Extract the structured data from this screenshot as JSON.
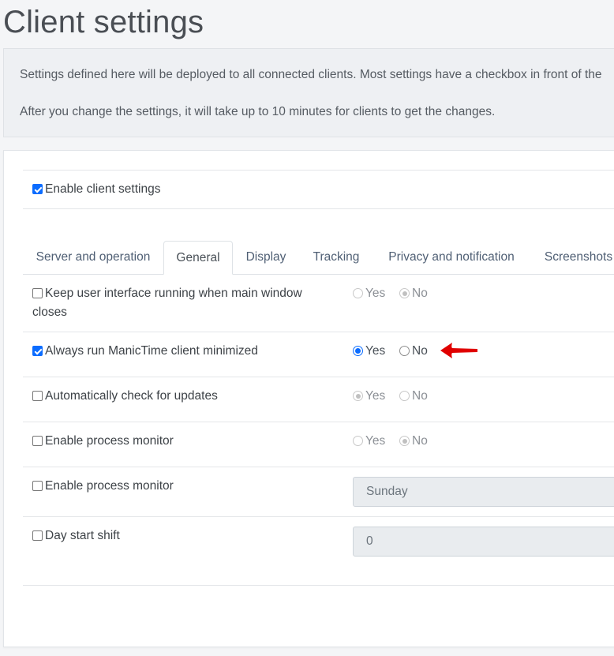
{
  "page": {
    "title": "Client settings"
  },
  "info": {
    "line1": "Settings defined here will be deployed to all connected clients. Most settings have a checkbox in front of the",
    "line2": "After you change the settings, it will take up to 10 minutes for clients to get the changes."
  },
  "enable": {
    "label": "Enable client settings",
    "checked": true
  },
  "tabs": [
    "Server and operation",
    "General",
    "Display",
    "Tracking",
    "Privacy and notification",
    "Screenshots"
  ],
  "active_tab": "General",
  "options": {
    "yes": "Yes",
    "no": "No"
  },
  "settings": [
    {
      "label_line1": "Keep user interface running when main window",
      "label_line2": "closes",
      "checked": false,
      "value": "No",
      "enabled": false
    },
    {
      "label": "Always run ManicTime client minimized",
      "checked": true,
      "value": "Yes",
      "enabled": true
    },
    {
      "label": "Automatically check for updates",
      "checked": false,
      "value": "Yes",
      "enabled": false
    },
    {
      "label": "Enable process monitor",
      "checked": false,
      "value": "No",
      "enabled": false
    },
    {
      "label": "Enable process monitor",
      "checked": false,
      "field_value": "Sunday"
    },
    {
      "label": "Day start shift",
      "checked": false,
      "field_value": "0"
    }
  ],
  "colors": {
    "accent": "#0b6cff",
    "arrow": "#e00000"
  }
}
